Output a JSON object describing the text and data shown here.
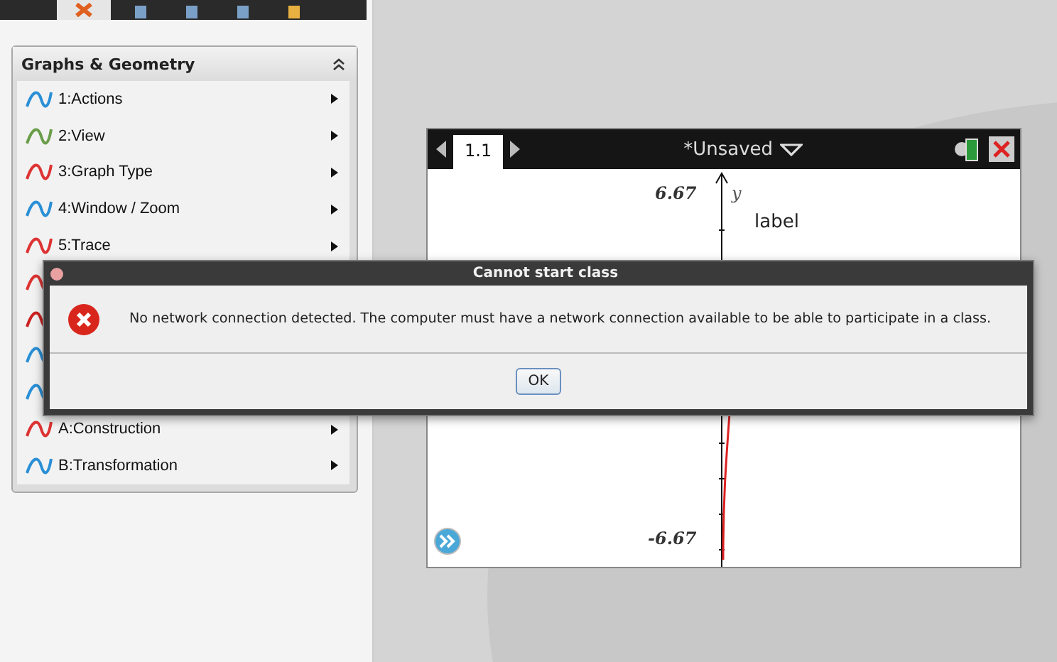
{
  "toolbar": {
    "tabs": [
      {
        "selected": true
      },
      {
        "selected": false
      },
      {
        "selected": false
      },
      {
        "selected": false
      },
      {
        "selected": false
      }
    ]
  },
  "menu_panel": {
    "title": "Graphs & Geometry",
    "items": [
      {
        "kind": "entry",
        "label": "1:Actions"
      },
      {
        "kind": "entry",
        "label": "2:View"
      },
      {
        "kind": "entry",
        "label": "3:Graph Type"
      },
      {
        "kind": "entry",
        "label": "4:Window / Zoom"
      },
      {
        "kind": "entry",
        "label": "5:Trace"
      },
      {
        "kind": "covered"
      },
      {
        "kind": "covered"
      },
      {
        "kind": "covered"
      },
      {
        "kind": "covered"
      },
      {
        "kind": "entry",
        "label": "A:Construction"
      },
      {
        "kind": "entry",
        "label": "B:Transformation"
      }
    ]
  },
  "document": {
    "pages": [
      {
        "label": "1.1",
        "selected": true
      }
    ],
    "title": "*Unsaved",
    "graph": {
      "y_max": "6.67",
      "y_min": "-6.67",
      "y_axis": "y",
      "text": "label"
    }
  },
  "dialog": {
    "title": "Cannot start class",
    "message": "No network connection detected. The computer must have a network connection available to be able to participate in a class.",
    "buttons": [
      "OK"
    ]
  }
}
